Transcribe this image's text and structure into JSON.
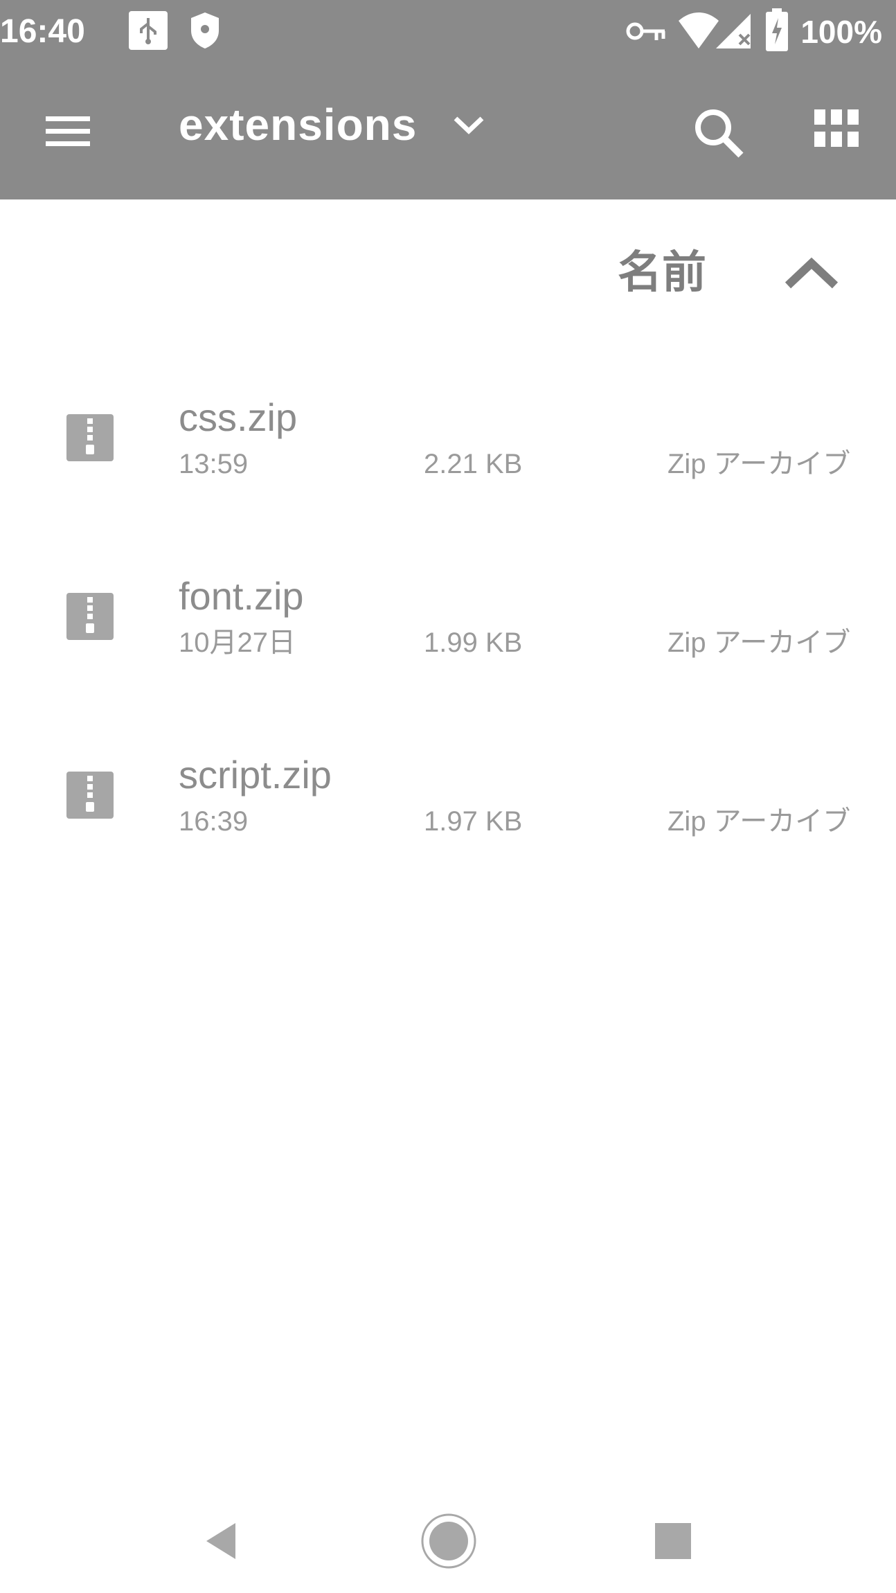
{
  "status_bar": {
    "time": "16:40",
    "battery_percent": "100%",
    "icons": [
      "usb-icon",
      "shield-icon",
      "vpn-key-icon",
      "wifi-icon",
      "cell-signal-icon",
      "battery-charging-icon"
    ]
  },
  "app_bar": {
    "title": "extensions",
    "icons": [
      "menu-icon",
      "chevron-down-icon",
      "search-icon",
      "grid-view-icon"
    ]
  },
  "sort": {
    "label": "名前",
    "direction_icon": "arrow-up-icon"
  },
  "files": [
    {
      "name": "css.zip",
      "date": "13:59",
      "size": "2.21 KB",
      "type": "Zip アーカイブ"
    },
    {
      "name": "font.zip",
      "date": "10月27日",
      "size": "1.99 KB",
      "type": "Zip アーカイブ"
    },
    {
      "name": "script.zip",
      "date": "16:39",
      "size": "1.97 KB",
      "type": "Zip アーカイブ"
    }
  ],
  "nav_bar": {
    "icons": [
      "back-icon",
      "home-icon",
      "recents-icon"
    ]
  }
}
